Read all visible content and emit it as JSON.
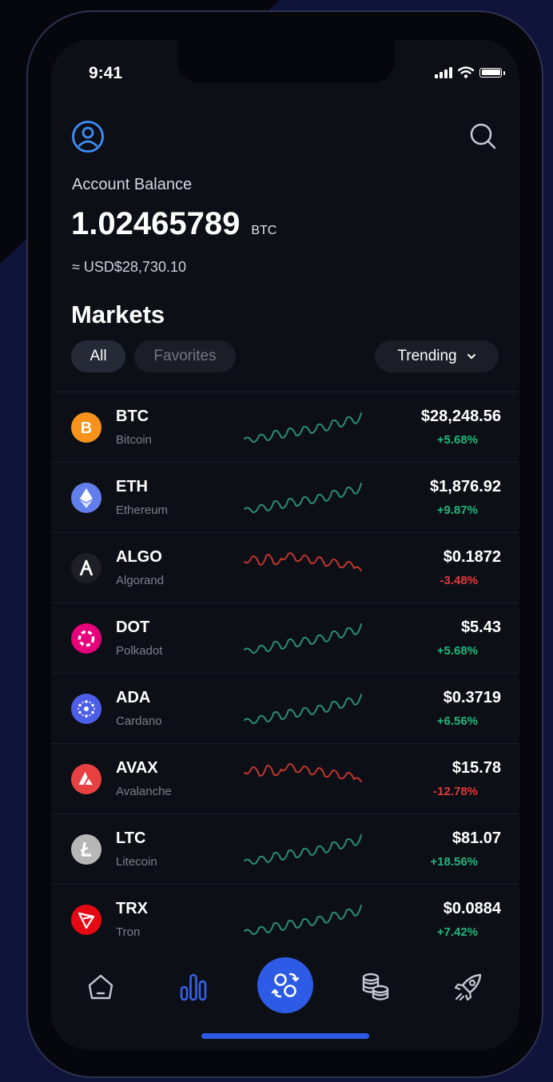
{
  "status_bar": {
    "time": "9:41"
  },
  "account": {
    "label": "Account Balance",
    "amount": "1.02465789",
    "unit": "BTC",
    "usd": "≈ USD$28,730.10"
  },
  "markets": {
    "title": "Markets",
    "filters": [
      "All",
      "Favorites"
    ],
    "active_filter": "All",
    "sort_label": "Trending"
  },
  "coins": [
    {
      "symbol": "BTC",
      "name": "Bitcoin",
      "price": "$28,248.56",
      "change": "+5.68%",
      "trend": "up",
      "icon_color": "#f7931a",
      "icon": "bitcoin-icon"
    },
    {
      "symbol": "ETH",
      "name": "Ethereum",
      "price": "$1,876.92",
      "change": "+9.87%",
      "trend": "up",
      "icon_color": "#627eea",
      "icon": "ethereum-icon"
    },
    {
      "symbol": "ALGO",
      "name": "Algorand",
      "price": "$0.1872",
      "change": "-3.48%",
      "trend": "down",
      "icon_color": "#1e1f24",
      "icon": "algorand-icon"
    },
    {
      "symbol": "DOT",
      "name": "Polkadot",
      "price": "$5.43",
      "change": "+5.68%",
      "trend": "up",
      "icon_color": "#e6007a",
      "icon": "polkadot-icon"
    },
    {
      "symbol": "ADA",
      "name": "Cardano",
      "price": "$0.3719",
      "change": "+6.56%",
      "trend": "up",
      "icon_color": "#4d5ee8",
      "icon": "cardano-icon"
    },
    {
      "symbol": "AVAX",
      "name": "Avalanche",
      "price": "$15.78",
      "change": "-12.78%",
      "trend": "down",
      "icon_color": "#e84142",
      "icon": "avalanche-icon"
    },
    {
      "symbol": "LTC",
      "name": "Litecoin",
      "price": "$81.07",
      "change": "+18.56%",
      "trend": "up",
      "icon_color": "#b7b7b7",
      "icon": "litecoin-icon"
    },
    {
      "symbol": "TRX",
      "name": "Tron",
      "price": "$0.0884",
      "change": "+7.42%",
      "trend": "up",
      "icon_color": "#e50914",
      "icon": "tron-icon"
    }
  ],
  "tab_bar": {
    "tabs": [
      "home-icon",
      "markets-chart-icon",
      "exchange-icon",
      "coins-stack-icon",
      "rocket-icon"
    ],
    "active": "markets-chart-icon"
  },
  "colors": {
    "accent": "#2e5be6",
    "positive": "#1fb67a",
    "negative": "#e0393a",
    "sparkline_up": "#2a8f72",
    "sparkline_down": "#c2362f",
    "background": "#0d0f16"
  }
}
